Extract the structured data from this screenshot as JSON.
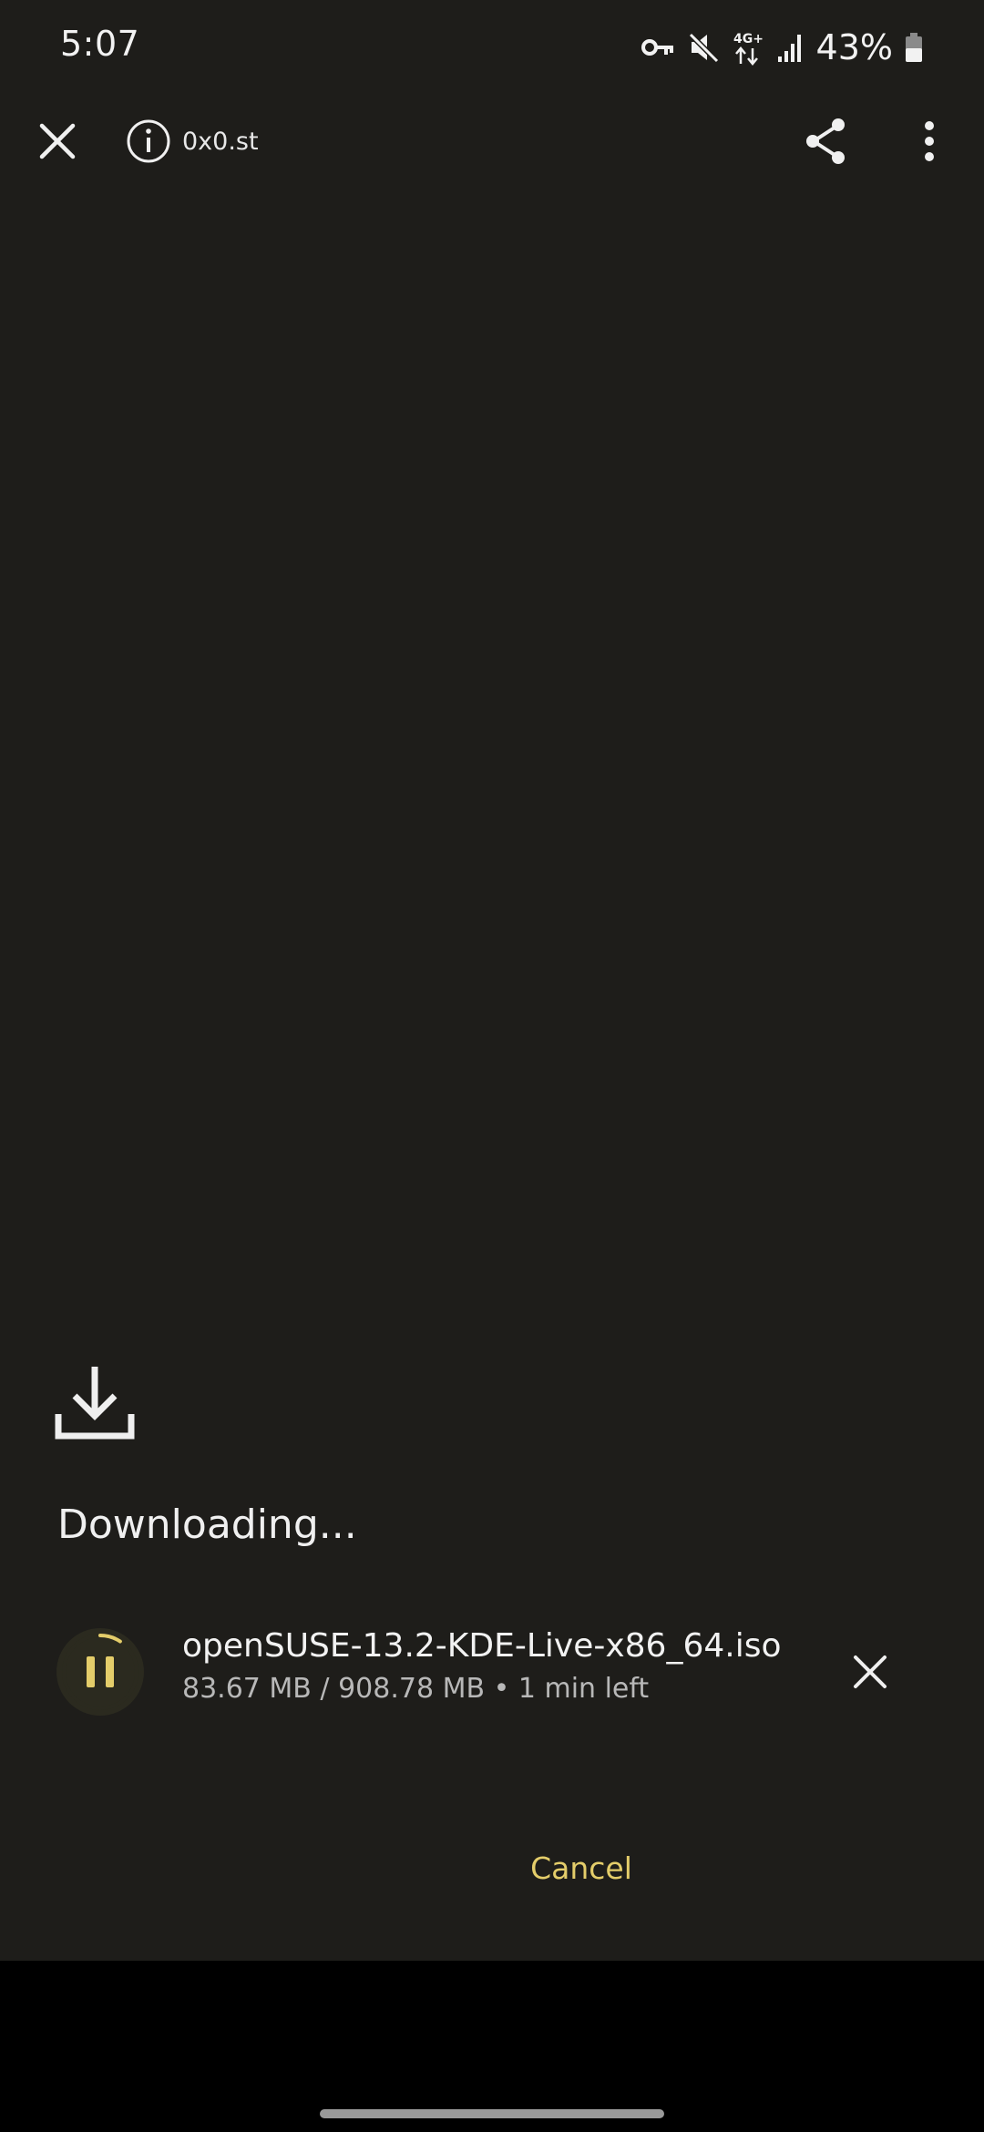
{
  "status_bar": {
    "time": "5:07",
    "battery_percent": "43%",
    "network_label": "4G+",
    "icons": [
      "vpn-key-icon",
      "muted-speaker-icon",
      "network-4g-icon",
      "signal-icon",
      "battery-icon"
    ]
  },
  "toolbar": {
    "site_label": "0x0.st",
    "icons": [
      "close-icon",
      "info-icon",
      "share-icon",
      "more-vert-icon"
    ]
  },
  "download": {
    "title": "Downloading...",
    "file_name": "openSUSE-13.2-KDE-Live-x86_64.iso",
    "downloaded": "83.67 MB",
    "total": "908.78 MB",
    "size_separator": " / ",
    "dot_separator": " • ",
    "time_left": "1 min left",
    "progress_fraction": 0.092,
    "cancel_label": "Cancel"
  },
  "colors": {
    "background": "#1e1d1a",
    "accent": "#e4cd6a",
    "text": "#f2f2f2",
    "secondary_text": "#b8b8b8",
    "pause_button_bg": "#2b2a1f",
    "nav_bar": "#000000"
  }
}
